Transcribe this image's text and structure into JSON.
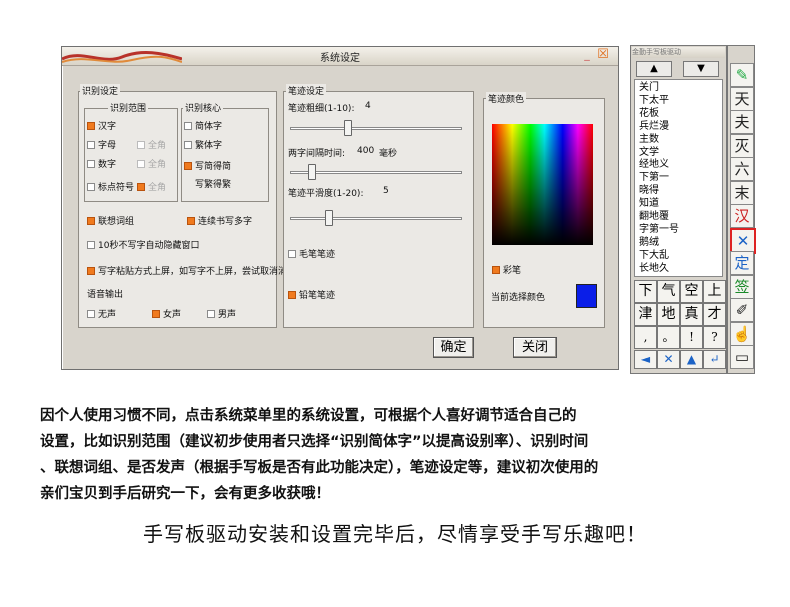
{
  "window": {
    "title": "系统设定",
    "recognition": {
      "group_label": "识别设定",
      "range": {
        "label": "识别范围",
        "options": [
          {
            "label": "汉字",
            "checked": true
          },
          {
            "label": "字母",
            "checked": false,
            "fullwidth": "全角"
          },
          {
            "label": "数字",
            "checked": false,
            "fullwidth": "全角"
          },
          {
            "label": "标点符号",
            "checked": false,
            "fullwidth": "全角"
          }
        ]
      },
      "core": {
        "label": "识别核心",
        "options": [
          {
            "label": "简体字",
            "checked": false
          },
          {
            "label": "繁体字",
            "checked": false
          },
          {
            "label": "写简得简",
            "label2": "写繁得繁",
            "checked": true
          }
        ]
      },
      "association": {
        "label": "联想词组",
        "checked": true
      },
      "continuous": {
        "label": "连续书写多字",
        "checked": true
      },
      "autohide": {
        "label": "10秒不写字自动隐藏窗口",
        "checked": false
      },
      "paste_mode": {
        "label": "写字粘贴方式上屏，如写字不上屏，尝试取消消选择",
        "checked": true
      },
      "voice": {
        "label": "语音输出",
        "options": [
          {
            "label": "无声",
            "checked": false
          },
          {
            "label": "女声",
            "checked": true
          },
          {
            "label": "男声",
            "checked": false
          }
        ]
      }
    },
    "stroke": {
      "group_label": "笔迹设定",
      "thickness": {
        "label": "笔迹粗细(1-10):",
        "value": "4",
        "level": 4
      },
      "interval": {
        "label": "两字间隔时间:",
        "value": "400",
        "unit": "毫秒",
        "level": 400
      },
      "smooth": {
        "label": "笔迹平滑度(1-20):",
        "value": "5",
        "level": 5
      },
      "brush": {
        "label": "毛笔笔迹",
        "checked": false
      },
      "pencil": {
        "label": "铅笔笔迹",
        "checked": true
      }
    },
    "color": {
      "group_label": "笔迹颜色",
      "colorful": {
        "label": "彩笔",
        "checked": true
      },
      "current_label": "当前选择颜色",
      "current_color": "#0a1ee8"
    },
    "ok_label": "确定",
    "close_label": "关闭"
  },
  "pad": {
    "title": "金勤手写板驱动",
    "up_icon": "up-triangle-icon",
    "down_icon": "down-triangle-icon",
    "candidates": [
      "关门",
      "下太平",
      "花板",
      "兵烂漫",
      "主数",
      "文学",
      "经地义",
      "下第一",
      "晓得",
      "知道",
      "翻地覆",
      "字第一号",
      "鹅绒",
      "下大乱",
      "长地久"
    ],
    "keys": [
      [
        "下",
        "气",
        "空",
        "上"
      ],
      [
        "津",
        "地",
        "真",
        "才"
      ],
      [
        ",",
        "。",
        "!",
        "?"
      ]
    ],
    "bottom_icons": [
      "back-arrow-icon",
      "close-x-icon",
      "up-arrow-icon",
      "enter-icon"
    ],
    "side": [
      "brush-icon",
      "天",
      "夫",
      "灭",
      "六",
      "末",
      "汉",
      "cross-icon",
      "定",
      "签",
      "eraser-icon",
      "hand-icon",
      "window-icon"
    ]
  },
  "caption": {
    "lines": [
      "因个人使用习惯不同，点击系统菜单里的系统设置，可根据个人喜好调节适合自己的",
      "设置，比如识别范围（建议初步使用者只选择“识别简体字”以提高设别率）、识别时间",
      "、联想词组、是否发声（根据手写板是否有此功能决定），笔迹设定等，建议初次使用的",
      "亲们宝贝到手后研究一下，会有更多收获哦！"
    ],
    "footer": "手写板驱动安装和设置完毕后，尽情享受手写乐趣吧！"
  }
}
